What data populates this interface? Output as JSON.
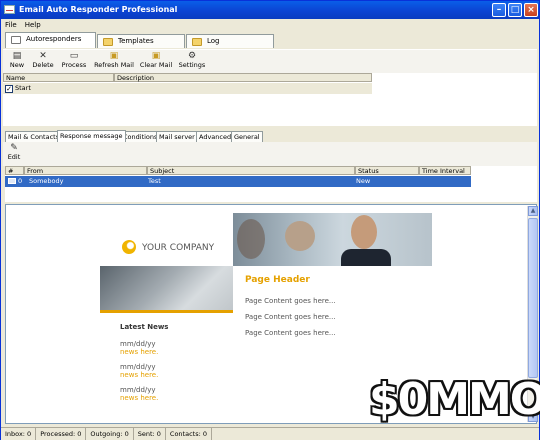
{
  "window": {
    "title": "Email Auto Responder Professional"
  },
  "menu": {
    "file": "File",
    "help": "Help"
  },
  "main_tabs": {
    "autoresponders": "Autoresponders",
    "templates": "Templates",
    "log": "Log"
  },
  "toolbar": {
    "new": "New",
    "delete": "Delete",
    "process": "Process",
    "refresh_mail": "Refresh Mail",
    "clear_mail": "Clear Mail",
    "settings": "Settings"
  },
  "responders_grid": {
    "headers": {
      "name": "Name",
      "description": "Description"
    },
    "rows": [
      {
        "checked": true,
        "name": "Start",
        "description": ""
      }
    ]
  },
  "lower_tabs": {
    "mail_contacts": "Mail & Contacts",
    "response_message": "Response message",
    "conditions": "Conditions",
    "mail_server": "Mail server",
    "advanced": "Advanced",
    "general": "General"
  },
  "edit_button": "Edit",
  "messages_grid": {
    "headers": {
      "num": "#",
      "from": "From",
      "subject": "Subject",
      "status": "Status",
      "interval": "Time Interval"
    },
    "rows": [
      {
        "num": "0",
        "from": "Somebody",
        "subject": "Test",
        "status": "New",
        "interval": ""
      }
    ]
  },
  "email_preview": {
    "logo_text": "YOUR COMPANY",
    "page_header": "Page Header",
    "content_lines": [
      "Page Content goes here...",
      "Page Content goes here...",
      "Page Content goes here..."
    ],
    "latest_news_title": "Latest News",
    "news": [
      {
        "date": "mm/dd/yy",
        "text": "news here."
      },
      {
        "date": "mm/dd/yy",
        "text": "news here."
      },
      {
        "date": "mm/dd/yy",
        "text": "news here."
      }
    ],
    "accent_color": "#e5a100"
  },
  "status_bar": {
    "inbox": "Inbox: 0",
    "processed": "Processed: 0",
    "outgoing": "Outgoing: 0",
    "sent": "Sent: 0",
    "contacts": "Contacts: 0"
  },
  "watermark": {
    "text": "$0MMO"
  }
}
